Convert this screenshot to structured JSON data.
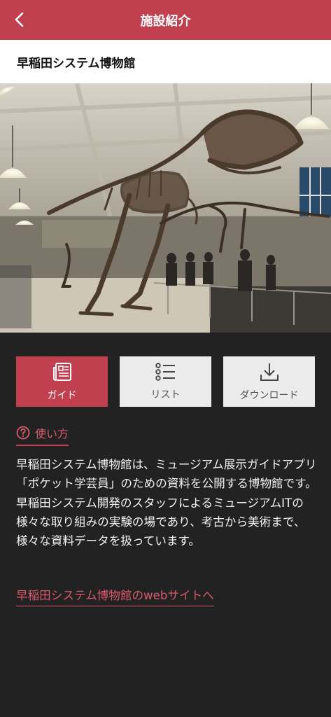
{
  "header": {
    "title": "施設紹介",
    "back_icon": "chevron-left-icon"
  },
  "museum": {
    "name": "早稲田システム博物館"
  },
  "buttons": [
    {
      "label": "ガイド",
      "icon": "newspaper-icon",
      "active": true
    },
    {
      "label": "リスト",
      "icon": "list-icon",
      "active": false
    },
    {
      "label": "ダウンロード",
      "icon": "download-icon",
      "active": false
    }
  ],
  "help": {
    "label": "使い方",
    "icon": "question-circle-icon"
  },
  "description": "早稲田システム博物館は、ミュージアム展示ガイドアプリ「ポケット学芸員」のための資料を公開する博物館です。早稲田システム開発のスタッフによるミュージアムITの様々な取り組みの実験の場であり、考古から美術まで、様々な資料データを扱っています。",
  "web_link": "早稲田システム博物館のwebサイトへ",
  "colors": {
    "accent": "#c0404f",
    "link": "#d9586b",
    "background": "#222222"
  }
}
